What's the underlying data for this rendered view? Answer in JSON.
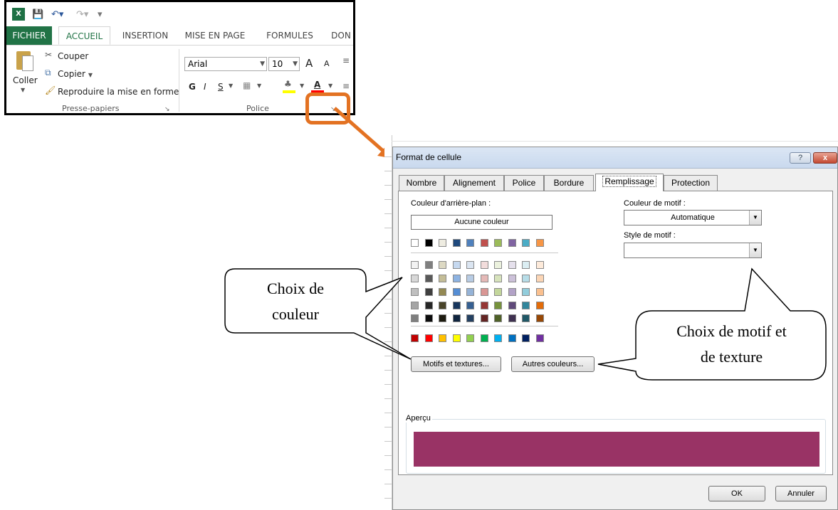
{
  "ribbon": {
    "app_icon": "excel-icon",
    "qat_icons": [
      "save-icon",
      "undo-icon",
      "redo-icon",
      "customize-icon"
    ],
    "tabs": [
      "FICHIER",
      "ACCUEIL",
      "INSERTION",
      "MISE EN PAGE",
      "FORMULES",
      "DON"
    ],
    "active_tab": "ACCUEIL",
    "clipboard": {
      "paste": "Coller",
      "cut": "Couper",
      "copy": "Copier",
      "format_painter": "Reproduire la mise en forme",
      "group_label": "Presse-papiers"
    },
    "font": {
      "font_name": "Arial",
      "font_size": "10",
      "grow": "A",
      "shrink": "A",
      "bold": "G",
      "italic": "I",
      "underline": "S",
      "font_color_letter": "A",
      "group_label": "Police"
    },
    "colors": {
      "file_tab": "#217346",
      "highlight": "#e37222"
    }
  },
  "dialog": {
    "title": "Format de cellule",
    "help": "?",
    "close": "x",
    "tabs": [
      "Nombre",
      "Alignement",
      "Police",
      "Bordure",
      "Remplissage",
      "Protection"
    ],
    "active_tab": "Remplissage",
    "background_color_label": "Couleur d'arrière-plan :",
    "no_color": "Aucune couleur",
    "theme_row": [
      "#ffffff",
      "#000000",
      "#eeece1",
      "#1f497d",
      "#4f81bd",
      "#c0504d",
      "#9bbb59",
      "#8064a2",
      "#4bacc6",
      "#f79646"
    ],
    "shade_rows": [
      [
        "#f2f2f2",
        "#7f7f7f",
        "#ddd9c3",
        "#c6d9f0",
        "#dbe5f1",
        "#f2dcdb",
        "#ebf1dd",
        "#e5e0ec",
        "#dbeef3",
        "#fdeada"
      ],
      [
        "#d8d8d8",
        "#595959",
        "#c4bd97",
        "#8db3e2",
        "#b8cce4",
        "#e5b9b7",
        "#d7e3bc",
        "#ccc1d9",
        "#b7dde8",
        "#fbd5b5"
      ],
      [
        "#bfbfbf",
        "#3f3f3f",
        "#938953",
        "#548dd4",
        "#95b3d7",
        "#d99694",
        "#c3d69b",
        "#b2a2c7",
        "#92cddc",
        "#fac08f"
      ],
      [
        "#a5a5a5",
        "#262626",
        "#494429",
        "#17365d",
        "#366092",
        "#953734",
        "#76923c",
        "#5f497a",
        "#31859b",
        "#e36c09"
      ],
      [
        "#7f7f7f",
        "#0c0c0c",
        "#1d1b10",
        "#0f243e",
        "#244061",
        "#632423",
        "#4f6128",
        "#3f3151",
        "#205867",
        "#974806"
      ]
    ],
    "standard_row": [
      "#c00000",
      "#ff0000",
      "#ffc000",
      "#ffff00",
      "#92d050",
      "#00b050",
      "#00b0f0",
      "#0070c0",
      "#002060",
      "#7030a0"
    ],
    "patterns_button": "Motifs et textures...",
    "more_colors_button": "Autres couleurs...",
    "pattern_color_label": "Couleur de motif :",
    "pattern_color_value": "Automatique",
    "pattern_style_label": "Style de motif :",
    "pattern_style_value": "",
    "preview_label": "Aperçu",
    "preview_color": "#993365",
    "ok": "OK",
    "cancel": "Annuler"
  },
  "callouts": {
    "color_choice": "Choix de couleur",
    "color_choice_lines": [
      "Choix de",
      "couleur"
    ],
    "pattern_choice": "Choix de motif et de texture",
    "pattern_choice_lines": [
      "Choix de motif et",
      "de texture"
    ]
  }
}
